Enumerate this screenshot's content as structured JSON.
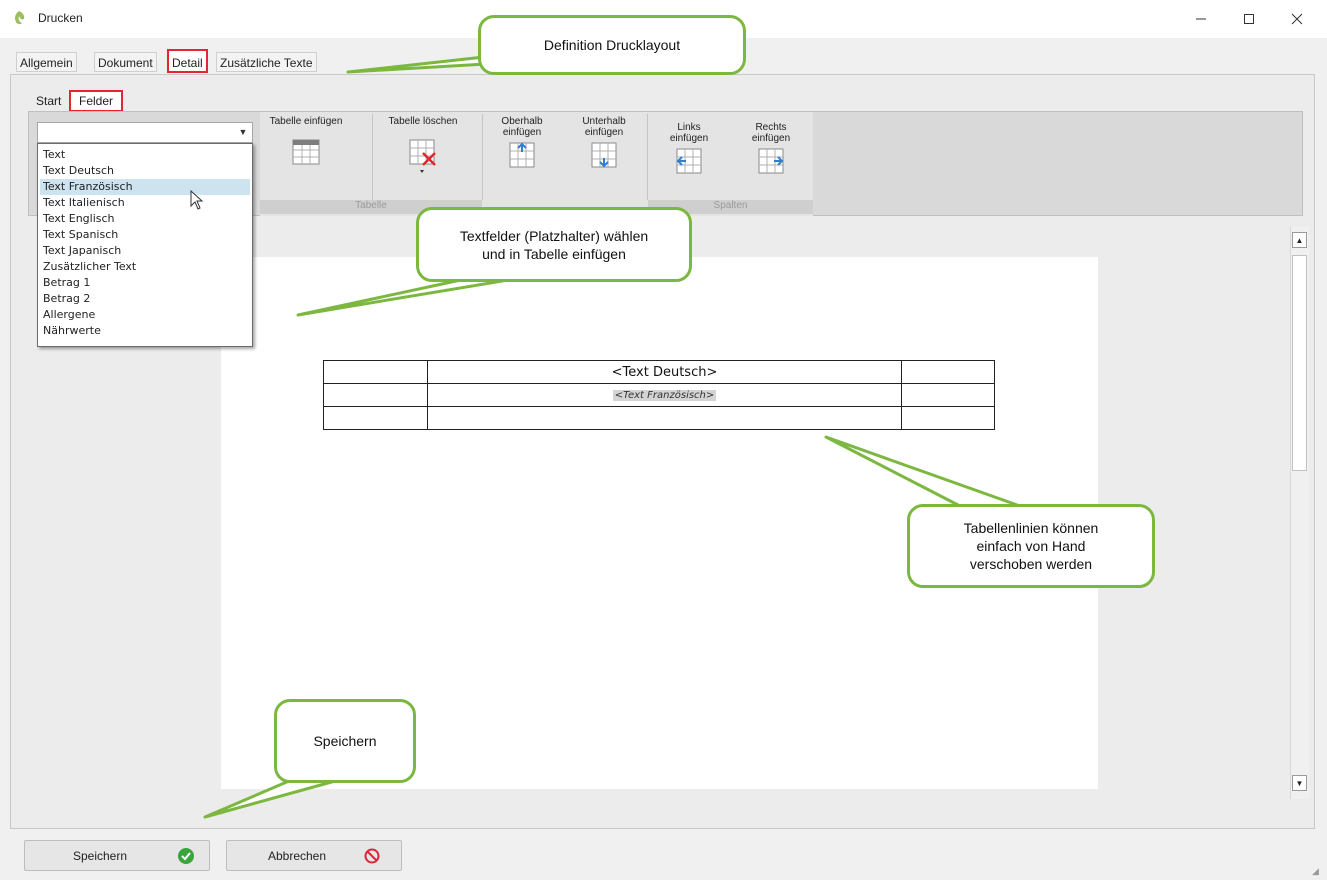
{
  "window": {
    "title": "Drucken",
    "minimize_icon": "minimize-icon",
    "maximize_icon": "maximize-icon",
    "close_icon": "close-icon"
  },
  "tabs": [
    {
      "label": "Allgemein"
    },
    {
      "label": "Dokument"
    },
    {
      "label": "Detail"
    },
    {
      "label": "Zusätzliche Texte"
    }
  ],
  "subtabs": [
    {
      "label": "Start"
    },
    {
      "label": "Felder"
    }
  ],
  "ribbon": {
    "combo_value": "",
    "buttons": [
      {
        "label": "Tabelle einfügen",
        "icon": "table-insert-icon"
      },
      {
        "label": "Tabelle löschen",
        "icon": "table-delete-icon"
      },
      {
        "label": "Oberhalb einfügen",
        "icon": "insert-above-icon"
      },
      {
        "label": "Unterhalb einfügen",
        "icon": "insert-below-icon"
      },
      {
        "label": "Links einfügen",
        "icon": "insert-left-icon"
      },
      {
        "label": "Rechts einfügen",
        "icon": "insert-right-icon"
      }
    ],
    "groups": [
      {
        "label": "Tabelle"
      },
      {
        "label": "Spalten"
      }
    ]
  },
  "dropdown": {
    "selected": "Text Französisch",
    "items": [
      "Text",
      "Text Deutsch",
      "Text Französisch",
      "Text Italienisch",
      "Text Englisch",
      "Text Spanisch",
      "Text Japanisch",
      "Zusätzlicher Text",
      "Betrag 1",
      "Betrag 2",
      "Allergene",
      "Nährwerte"
    ]
  },
  "document": {
    "table": {
      "rows": [
        [
          "",
          "<Text Deutsch>",
          ""
        ],
        [
          "",
          "<Text Französisch>",
          ""
        ],
        [
          "",
          "",
          ""
        ]
      ]
    }
  },
  "callouts": {
    "layout": "Definition Drucklayout",
    "felder_line1": "Textfelder (Platzhalter) wählen",
    "felder_line2": "und in Tabelle einfügen",
    "linien_line1": "Tabellenlinien können",
    "linien_line2": "einfach von Hand",
    "linien_line3": "verschoben werden",
    "speichern": "Speichern"
  },
  "footer": {
    "save_label": "Speichern",
    "save_icon": "check-circle-icon",
    "cancel_label": "Abbrechen",
    "cancel_icon": "cancel-circle-icon"
  },
  "colors": {
    "highlight_border": "#e0282e",
    "callout_border": "#7cb740",
    "selected_item": "#cde3f0",
    "save_icon": "#3aa53a",
    "cancel_icon": "#d9263a"
  }
}
